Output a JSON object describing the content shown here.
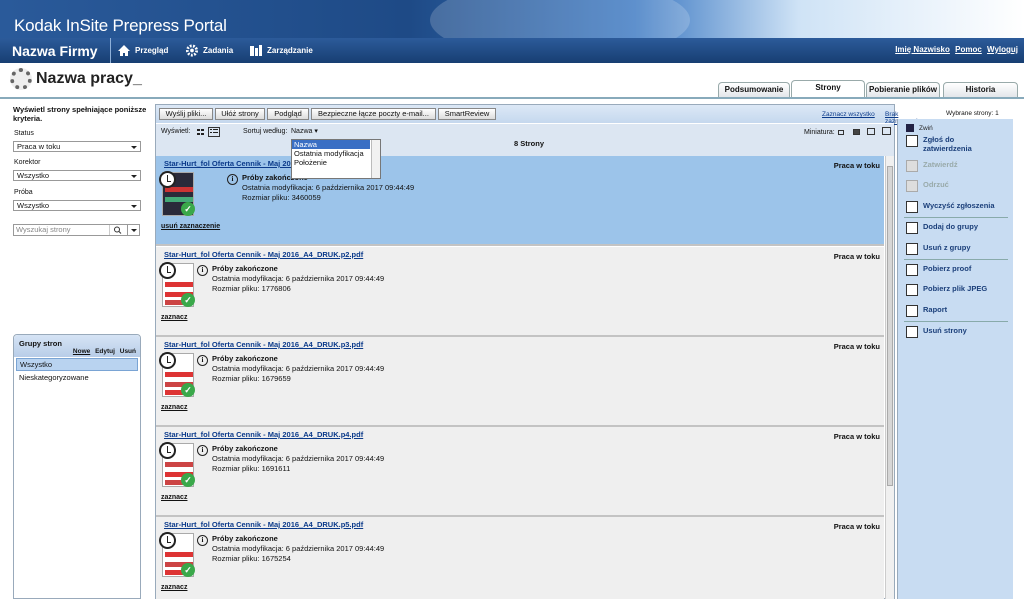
{
  "app_title": "Kodak InSite Prepress Portal",
  "nav": {
    "company": "Nazwa Firmy",
    "items": [
      {
        "label": "Przegląd",
        "icon": "home-icon"
      },
      {
        "label": "Zadania",
        "icon": "gear-icon"
      },
      {
        "label": "Zarządzanie",
        "icon": "manage-icon"
      }
    ],
    "user": {
      "name": "Imię Nazwisko",
      "help": "Pomoc",
      "logout": "Wyloguj"
    }
  },
  "job": {
    "title": "Nazwa pracy_"
  },
  "tabs": [
    "Podsumowanie",
    "Strony",
    "Pobieranie plików",
    "Historia"
  ],
  "active_tab": "Strony",
  "filters": {
    "intro": "Wyświetl strony spełniające poniższe kryteria.",
    "status_label": "Status",
    "status_value": "Praca w toku",
    "corrector_label": "Korektor",
    "corrector_value": "Wszystko",
    "proof_label": "Próba",
    "proof_value": "Wszystko",
    "search_placeholder": "Wyszukaj strony"
  },
  "groups": {
    "title": "Grupy stron",
    "actions": [
      "Nowe",
      "Edytuj",
      "Usuń"
    ],
    "items": [
      "Wszystko",
      "Nieskategoryzowane"
    ]
  },
  "toolbar": {
    "buttons": [
      "Wyślij pliki...",
      "Ułóż strony",
      "Podgląd",
      "Bezpieczne łącze poczty e-mail...",
      "SmartReview"
    ],
    "select_all": "Zaznacz wszystko",
    "clear_selection": "Brak zaznaczenia",
    "selected_label": "Wybrane strony:",
    "selected_count": "1"
  },
  "viewbar": {
    "view_label": "Wyświetl:",
    "sort_label": "Sortuj według:",
    "sort_value": "Nazwa",
    "sort_options": [
      "Nazwa",
      "Ostatnia modyfikacja",
      "Położenie"
    ],
    "thumb_label": "Miniatura:",
    "count": "8 Strony"
  },
  "pages": [
    {
      "name": "Star-Hurt_fol Oferta Cennik - Maj 2016_A4_DRUK.p1.pdf",
      "status": "Praca w toku",
      "proof": "Próby zakończone",
      "modified": "Ostatnia modyfikacja: 6 października 2017 09:44:49",
      "size": "Rozmiar pliku: 3460059",
      "action": "usuń zaznaczenie",
      "selected": true
    },
    {
      "name": "Star-Hurt_fol Oferta Cennik - Maj 2016_A4_DRUK.p2.pdf",
      "status": "Praca w toku",
      "proof": "Próby zakończone",
      "modified": "Ostatnia modyfikacja: 6 października 2017 09:44:49",
      "size": "Rozmiar pliku: 1776806",
      "action": "zaznacz",
      "selected": false
    },
    {
      "name": "Star-Hurt_fol Oferta Cennik - Maj 2016_A4_DRUK.p3.pdf",
      "status": "Praca w toku",
      "proof": "Próby zakończone",
      "modified": "Ostatnia modyfikacja: 6 października 2017 09:44:49",
      "size": "Rozmiar pliku: 1679659",
      "action": "zaznacz",
      "selected": false
    },
    {
      "name": "Star-Hurt_fol Oferta Cennik - Maj 2016_A4_DRUK.p4.pdf",
      "status": "Praca w toku",
      "proof": "Próby zakończone",
      "modified": "Ostatnia modyfikacja: 6 października 2017 09:44:49",
      "size": "Rozmiar pliku: 1691611",
      "action": "zaznacz",
      "selected": false
    },
    {
      "name": "Star-Hurt_fol Oferta Cennik - Maj 2016_A4_DRUK.p5.pdf",
      "status": "Praca w toku",
      "proof": "Próby zakończone",
      "modified": "Ostatnia modyfikacja: 6 października 2017 09:44:49",
      "size": "Rozmiar pliku: 1675254",
      "action": "zaznacz",
      "selected": false
    }
  ],
  "right_panel": {
    "collapse": "Zwiń",
    "actions": [
      {
        "label": "Zgłoś do zatwierdzenia",
        "enabled": true
      },
      {
        "label": "Zatwierdź",
        "enabled": false
      },
      {
        "label": "Odrzuć",
        "enabled": false
      },
      {
        "label": "Wyczyść zgłoszenia",
        "enabled": true
      },
      {
        "label": "Dodaj do grupy",
        "enabled": true
      },
      {
        "label": "Usuń z grupy",
        "enabled": true
      },
      {
        "label": "Pobierz proof",
        "enabled": true
      },
      {
        "label": "Pobierz plik JPEG",
        "enabled": true
      },
      {
        "label": "Raport",
        "enabled": true
      },
      {
        "label": "Usuń strony",
        "enabled": true
      }
    ]
  },
  "colors": {
    "nav_bg": "#1e4a86",
    "selected_row": "#9cc4ea",
    "right_panel": "#c8dcf2",
    "dropdown_highlight": "#3a6fc4"
  }
}
